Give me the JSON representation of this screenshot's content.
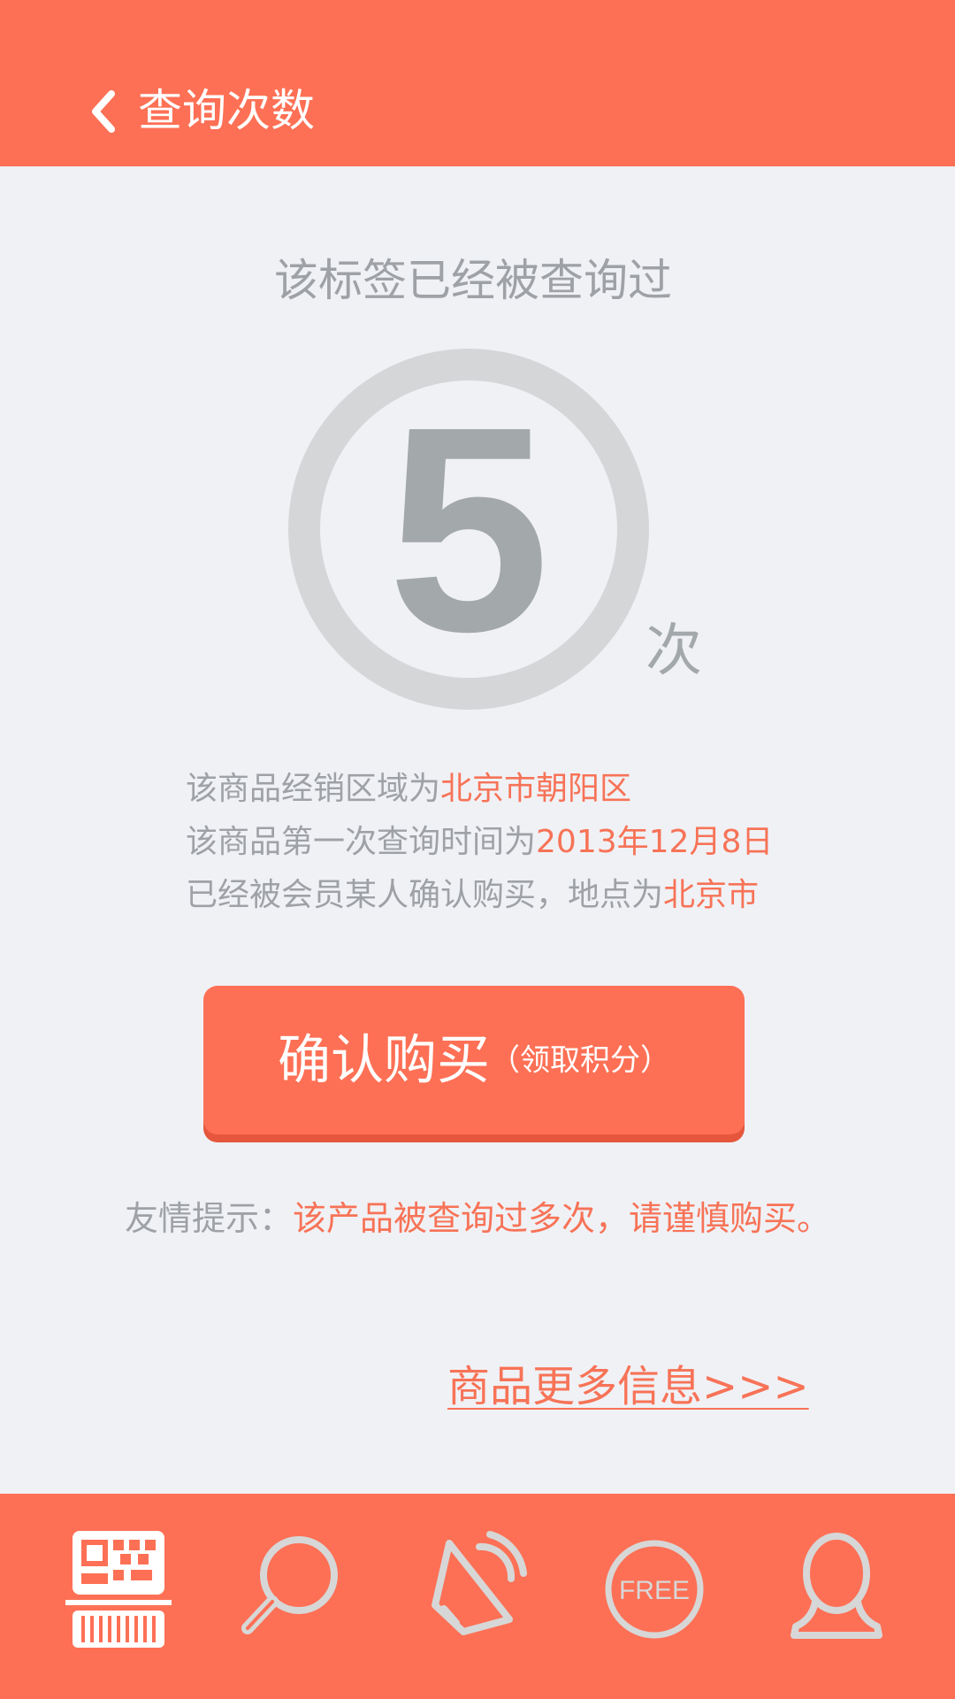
{
  "header": {
    "title": "查询次数",
    "back_icon": "chevron-left-icon"
  },
  "query": {
    "subtitle": "该标签已经被查询过",
    "count": "5",
    "count_unit": "次"
  },
  "info": {
    "region_prefix": "该商品经销区域为",
    "region_value": "北京市朝阳区",
    "first_query_prefix": "该商品第一次查询时间为",
    "first_query_value": "2013年12月8日",
    "purchase_prefix": "已经被会员某人确认购买，地点为",
    "purchase_value": "北京市"
  },
  "confirm_button": {
    "label": "确认购买",
    "sub_label": "（领取积分）"
  },
  "tip": {
    "prefix": "友情提示：",
    "message": "该产品被查询过多次，请谨慎购买。"
  },
  "more_link": "商品更多信息>>>",
  "tabbar": {
    "items": [
      {
        "icon": "qr-barcode-icon",
        "active": true
      },
      {
        "icon": "search-icon",
        "active": false
      },
      {
        "icon": "megaphone-icon",
        "active": false
      },
      {
        "icon": "free-icon",
        "label": "FREE",
        "active": false
      },
      {
        "icon": "user-icon",
        "active": false
      }
    ]
  },
  "colors": {
    "brand": "#fd7055",
    "highlight": "#f77357",
    "text_gray": "#9ea1a6",
    "background": "#f0f1f5",
    "ring": "#d5d6d8",
    "icon_inactive": "#d7d7d7",
    "icon_active": "#ffffff"
  }
}
